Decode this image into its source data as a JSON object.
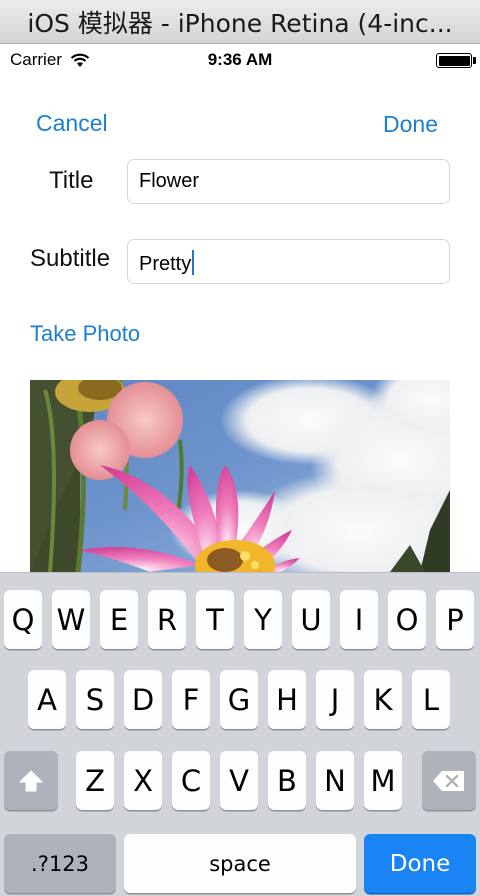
{
  "window": {
    "title": "iOS 模拟器 - iPhone Retina (4-inc..."
  },
  "status_bar": {
    "carrier": "Carrier",
    "time": "9:36 AM",
    "wifi_icon": "wifi-icon",
    "battery_icon": "battery-icon",
    "battery_level": 1.0
  },
  "nav": {
    "cancel_label": "Cancel",
    "done_label": "Done",
    "accent": "#1c7fd0"
  },
  "form": {
    "title_label": "Title",
    "title_value": "Flower",
    "subtitle_label": "Subtitle",
    "subtitle_value": "Pretty"
  },
  "take_photo_label": "Take Photo",
  "photo": {
    "description_icon": "photo-image"
  },
  "keyboard": {
    "row1": [
      "Q",
      "W",
      "E",
      "R",
      "T",
      "Y",
      "U",
      "I",
      "O",
      "P"
    ],
    "row2": [
      "A",
      "S",
      "D",
      "F",
      "G",
      "H",
      "J",
      "K",
      "L"
    ],
    "row3": [
      "Z",
      "X",
      "C",
      "V",
      "B",
      "N",
      "M"
    ],
    "numbers_label": ".?123",
    "space_label": "space",
    "done_label": "Done",
    "shift_icon": "shift-icon",
    "delete_icon": "delete-icon",
    "done_color": "#1a84f5"
  }
}
